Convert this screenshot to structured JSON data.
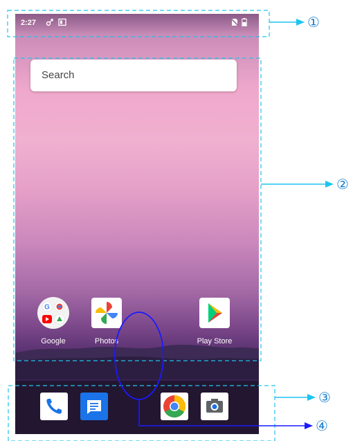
{
  "status_bar": {
    "time": "2:27"
  },
  "search": {
    "placeholder": "Search"
  },
  "home_apps": [
    {
      "label": "Google",
      "icon": "google-folder-icon"
    },
    {
      "label": "Photos",
      "icon": "photos-pinwheel-icon"
    },
    {
      "label": "Play Store",
      "icon": "play-store-icon"
    }
  ],
  "dock_apps": [
    {
      "icon": "phone-icon"
    },
    {
      "icon": "messages-icon"
    },
    {
      "icon": "chrome-icon"
    },
    {
      "icon": "camera-icon"
    }
  ],
  "callouts": [
    "①",
    "②",
    "③",
    "④"
  ],
  "colors": {
    "callout_line": "#1ec3f0",
    "callout_arrow": "#1b7fd0",
    "annotation_ellipse": "#1a1aff"
  }
}
